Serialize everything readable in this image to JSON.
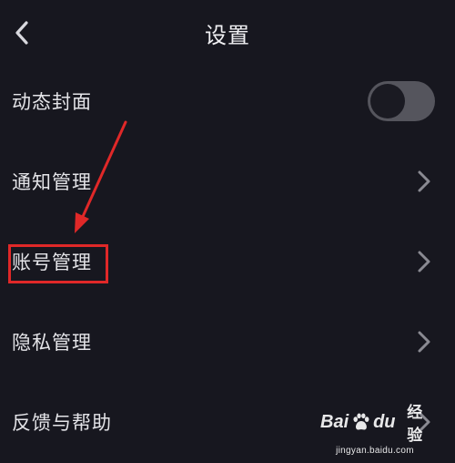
{
  "header": {
    "title": "设置",
    "back_icon": "chevron-left-icon"
  },
  "settings": {
    "items": [
      {
        "label": "动态封面",
        "control": "toggle",
        "toggle_on": false
      },
      {
        "label": "通知管理",
        "control": "chevron"
      },
      {
        "label": "账号管理",
        "control": "chevron",
        "highlighted": true
      },
      {
        "label": "隐私管理",
        "control": "chevron"
      },
      {
        "label": "反馈与帮助",
        "control": "chevron"
      }
    ]
  },
  "annotation": {
    "arrow_color": "#e02828",
    "box_color": "#e02828"
  },
  "watermark": {
    "brand_left": "Bai",
    "brand_right": "du",
    "product": "经验",
    "url": "jingyan.baidu.com"
  },
  "colors": {
    "background": "#17171f",
    "text": "#e4e4e8",
    "chevron": "#8a8a92",
    "toggle_track": "#55555d",
    "toggle_knob": "#1a1a22"
  }
}
